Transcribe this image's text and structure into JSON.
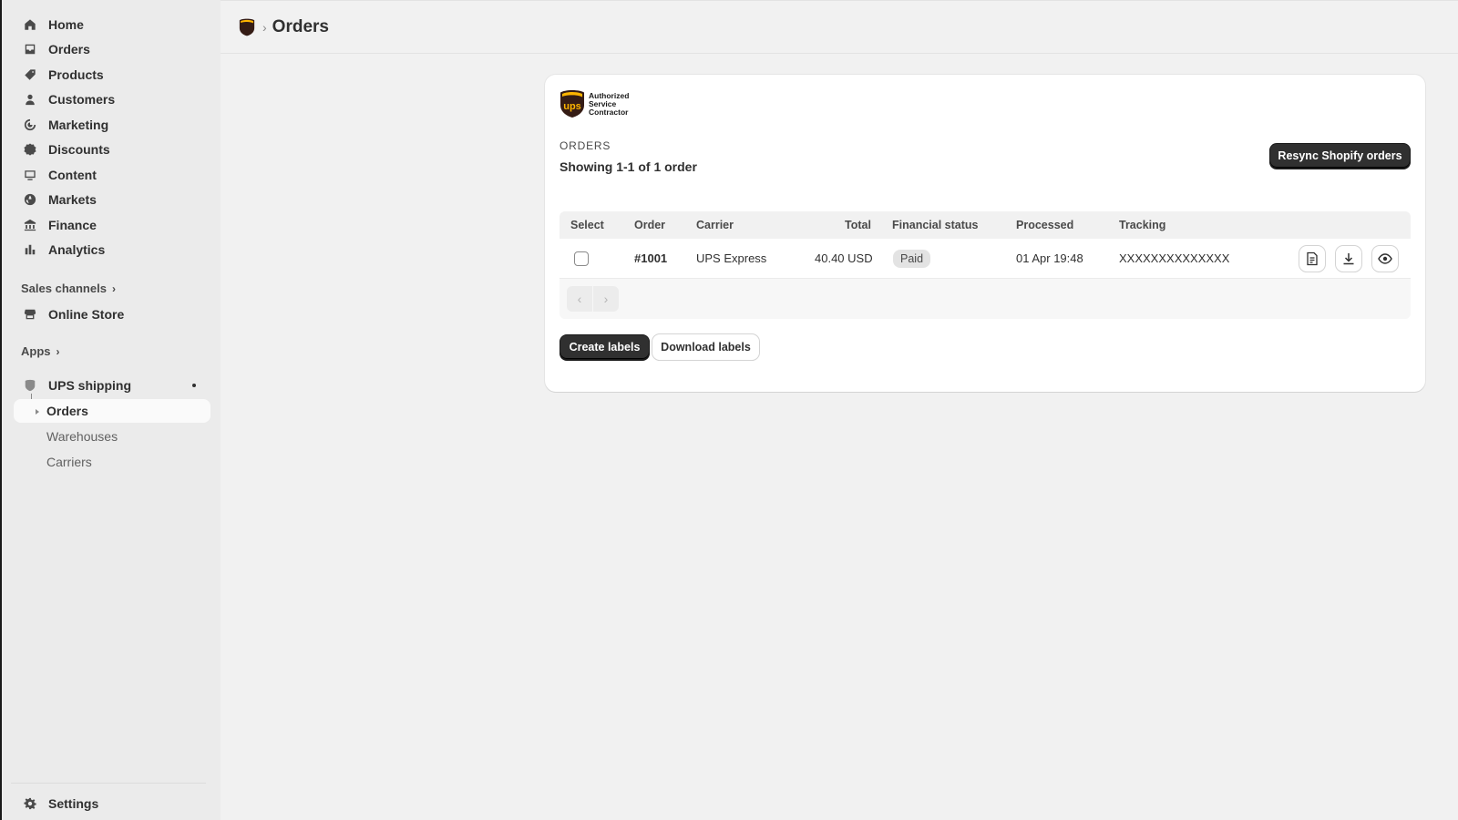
{
  "sidebar": {
    "nav": [
      {
        "label": "Home",
        "icon": "home-icon"
      },
      {
        "label": "Orders",
        "icon": "inbox-icon"
      },
      {
        "label": "Products",
        "icon": "tag-icon"
      },
      {
        "label": "Customers",
        "icon": "person-icon"
      },
      {
        "label": "Marketing",
        "icon": "target-icon"
      },
      {
        "label": "Discounts",
        "icon": "discount-icon"
      },
      {
        "label": "Content",
        "icon": "content-icon"
      },
      {
        "label": "Markets",
        "icon": "globe-icon"
      },
      {
        "label": "Finance",
        "icon": "bank-icon"
      },
      {
        "label": "Analytics",
        "icon": "bar-chart-icon"
      }
    ],
    "sales_channels_label": "Sales channels",
    "online_store_label": "Online Store",
    "apps_label": "Apps",
    "app_name": "UPS shipping",
    "app_subitems": [
      "Orders",
      "Warehouses",
      "Carriers"
    ],
    "settings_label": "Settings"
  },
  "header": {
    "title": "Orders",
    "separator": "›"
  },
  "card": {
    "logo_text": "Authorized Service Contractor",
    "logo_wordmark": "ups",
    "caption": "ORDERS",
    "showing": "Showing 1-1 of 1 order",
    "resync_label": "Resync Shopify orders",
    "create_labels": "Create labels",
    "download_labels": "Download labels"
  },
  "table": {
    "columns": [
      "Select",
      "Order",
      "Carrier",
      "Total",
      "Financial status",
      "Processed",
      "Tracking"
    ],
    "rows": [
      {
        "order": "#1001",
        "carrier": "UPS Express",
        "total": "40.40 USD",
        "financial_status": "Paid",
        "processed": "01 Apr 19:48",
        "tracking": "XXXXXXXXXXXXXX",
        "checked": false
      }
    ],
    "row_actions": [
      "document-icon",
      "download-icon",
      "eye-icon"
    ]
  },
  "colors": {
    "ups_brown": "#351c15",
    "ups_gold": "#ffb500",
    "primary_button": "#303030"
  }
}
